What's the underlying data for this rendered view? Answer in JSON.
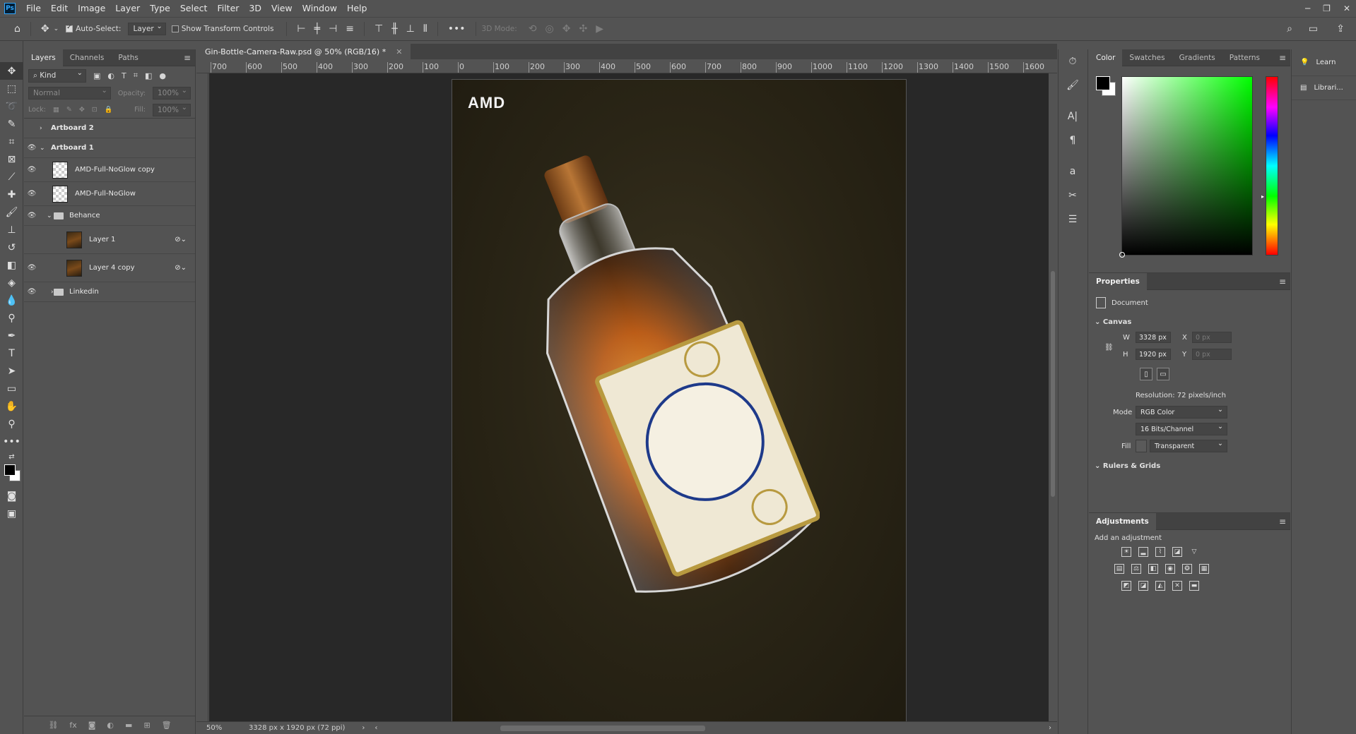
{
  "menu": {
    "items": [
      "File",
      "Edit",
      "Image",
      "Layer",
      "Type",
      "Select",
      "Filter",
      "3D",
      "View",
      "Window",
      "Help"
    ]
  },
  "options": {
    "auto_select_label": "Auto-Select:",
    "auto_select_target": "Layer",
    "show_transform_label": "Show Transform Controls",
    "mode_3d_label": "3D Mode:"
  },
  "layers_panel": {
    "tabs": [
      "Layers",
      "Channels",
      "Paths"
    ],
    "filter_kind": "Kind",
    "blend_mode": "Normal",
    "opacity_label": "Opacity:",
    "opacity_value": "100%",
    "lock_label": "Lock:",
    "fill_label": "Fill:",
    "fill_value": "100%",
    "layers": [
      {
        "name": "Artboard 2"
      },
      {
        "name": "Artboard 1"
      },
      {
        "name": "AMD-Full-NoGlow copy"
      },
      {
        "name": "AMD-Full-NoGlow"
      },
      {
        "name": "Behance"
      },
      {
        "name": "Layer 1"
      },
      {
        "name": "Layer 4 copy"
      },
      {
        "name": "Linkedin"
      }
    ]
  },
  "document": {
    "tab_title": "Gin-Bottle-Camera-Raw.psd @ 50% (RGB/16) *",
    "ruler_h": [
      "700",
      "600",
      "500",
      "400",
      "300",
      "200",
      "100",
      "0",
      "100",
      "200",
      "300",
      "400",
      "500",
      "600",
      "700",
      "800",
      "900",
      "1000",
      "1100",
      "1200",
      "1300",
      "1400",
      "1500",
      "1600"
    ],
    "artboard_logo": "AMD",
    "zoom": "50%",
    "doc_info": "3328 px x 1920 px (72 ppi)"
  },
  "color_panel": {
    "tabs": [
      "Color",
      "Swatches",
      "Gradients",
      "Patterns"
    ]
  },
  "properties_panel": {
    "title": "Properties",
    "doc_label": "Document",
    "canvas_label": "Canvas",
    "w_label": "W",
    "w_value": "3328 px",
    "h_label": "H",
    "h_value": "1920 px",
    "x_label": "X",
    "x_placeholder": "0 px",
    "y_label": "Y",
    "y_placeholder": "0 px",
    "resolution": "Resolution: 72 pixels/inch",
    "mode_label": "Mode",
    "mode_value": "RGB Color",
    "bits_value": "16 Bits/Channel",
    "fill_label": "Fill",
    "fill_value": "Transparent",
    "rulers_label": "Rulers & Grids"
  },
  "adjustments_panel": {
    "title": "Adjustments",
    "subtitle": "Add an adjustment"
  },
  "far_right": {
    "learn": "Learn",
    "libraries": "Librari..."
  },
  "colors": {
    "bg": "#535353",
    "canvas": "#282828",
    "accent": "#31a8ff"
  }
}
